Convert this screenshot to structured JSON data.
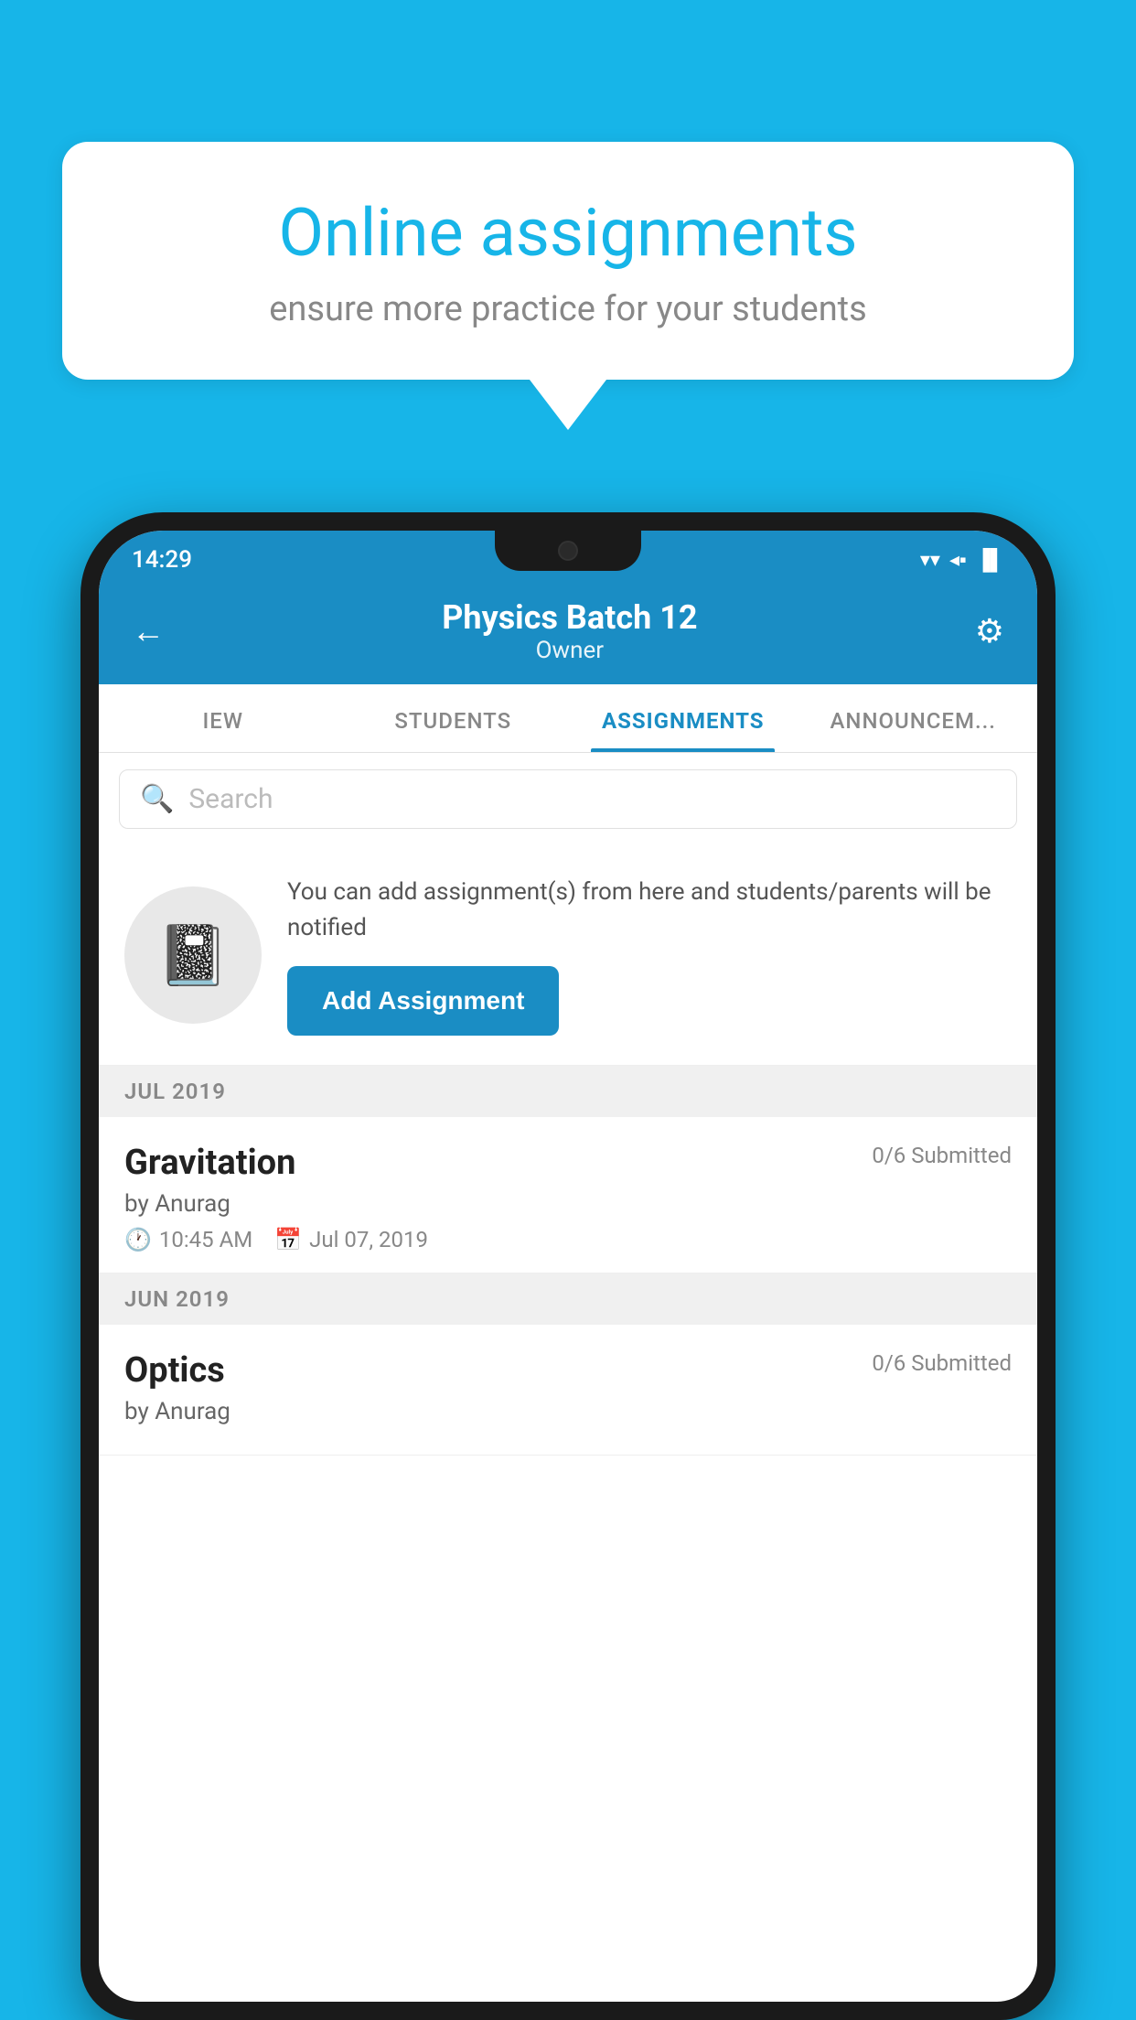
{
  "background_color": "#17B5E8",
  "speech_bubble": {
    "title": "Online assignments",
    "subtitle": "ensure more practice for your students"
  },
  "status_bar": {
    "time": "14:29",
    "wifi": "▼",
    "signal": "◀",
    "battery": "▐"
  },
  "header": {
    "title": "Physics Batch 12",
    "subtitle": "Owner",
    "back_label": "←",
    "gear_label": "⚙"
  },
  "tabs": [
    {
      "label": "IEW",
      "active": false
    },
    {
      "label": "STUDENTS",
      "active": false
    },
    {
      "label": "ASSIGNMENTS",
      "active": true
    },
    {
      "label": "ANNOUNCEM...",
      "active": false
    }
  ],
  "search": {
    "placeholder": "Search"
  },
  "promo": {
    "description": "You can add assignment(s) from here and students/parents will be notified",
    "button_label": "Add Assignment"
  },
  "sections": [
    {
      "label": "JUL 2019",
      "assignments": [
        {
          "title": "Gravitation",
          "submitted": "0/6 Submitted",
          "by": "by Anurag",
          "time": "10:45 AM",
          "date": "Jul 07, 2019"
        }
      ]
    },
    {
      "label": "JUN 2019",
      "assignments": [
        {
          "title": "Optics",
          "submitted": "0/6 Submitted",
          "by": "by Anurag",
          "time": "",
          "date": ""
        }
      ]
    }
  ]
}
